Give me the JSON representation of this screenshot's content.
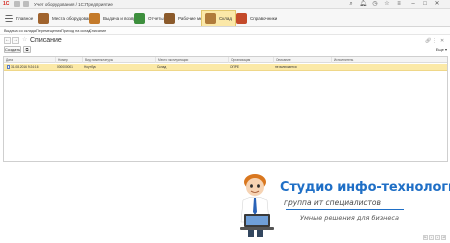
{
  "titlebar": {
    "logo": "1С",
    "title": "Учет оборудования / 1С:Предприятие",
    "icons": [
      "menu-icon",
      "history-icon"
    ]
  },
  "sections": [
    {
      "label": "Главное",
      "icon": "menu-icon",
      "color": "#666666"
    },
    {
      "label": "Места оборудования",
      "icon": "places-icon",
      "color": "#a0632d"
    },
    {
      "label": "Выдача и возврат",
      "icon": "issue-icon",
      "color": "#c47a2a"
    },
    {
      "label": "Отчеты",
      "icon": "reports-icon",
      "color": "#3d8f3d"
    },
    {
      "label": "Рабочие места",
      "icon": "workplace-icon",
      "color": "#8b5a2b"
    },
    {
      "label": "Склад",
      "icon": "warehouse-icon",
      "color": "#b07b3a",
      "active": true
    },
    {
      "label": "Справочники",
      "icon": "catalogs-icon",
      "color": "#c44a2a"
    }
  ],
  "navlinks": [
    "Выдача со склада",
    "Перемещения",
    "Приход на склад",
    "Списание"
  ],
  "form": {
    "title": "Списание",
    "buttons": [
      "Создать"
    ],
    "more_label": "Еще"
  },
  "table": {
    "columns": [
      "Дата",
      "Номер",
      "Вид номенклатуры",
      "Место эксплуатации",
      "Организация",
      "Описание",
      "Исполнитель"
    ],
    "rows": [
      {
        "date": "31.08.2016 9:24:16",
        "number": "000000001",
        "kind": "Ноутбук",
        "place": "Склад",
        "org": "ОПРЕ",
        "descr": "не включается",
        "executor": ""
      }
    ]
  },
  "banner": {
    "title": "Студио инфо-технологии",
    "subtitle": "группа ит специалистов",
    "slogan": "Умные решения для бизнеса"
  },
  "colors": {
    "accent": "#1f6fc6",
    "selected_row": "#fbe9a7",
    "logo": "#d4271f"
  }
}
